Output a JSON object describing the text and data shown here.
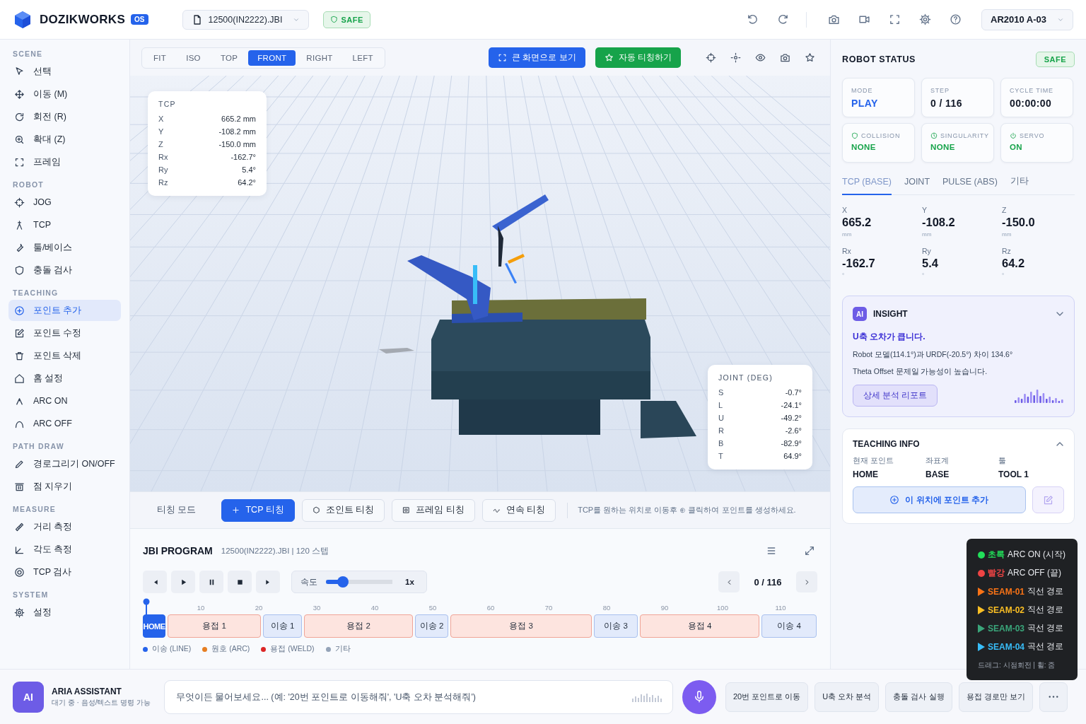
{
  "app": {
    "name": "DOZIKWORKS",
    "badge": "OS"
  },
  "file_menu": {
    "label": "12500(IN2222).JBI"
  },
  "safety_badge": "SAFE",
  "robot_select": {
    "label": "AR2010 A-03"
  },
  "view_tabs": [
    {
      "label": "FIT",
      "selected": false
    },
    {
      "label": "ISO",
      "selected": false
    },
    {
      "label": "TOP",
      "selected": false
    },
    {
      "label": "FRONT",
      "selected": true
    },
    {
      "label": "RIGHT",
      "selected": false
    },
    {
      "label": "LEFT",
      "selected": false
    }
  ],
  "view_buttons": [
    {
      "label": "큰 화면으로 보기",
      "kind": "primary"
    },
    {
      "label": "자동 티칭하기",
      "kind": "success"
    }
  ],
  "sidebar": [
    {
      "title": "SCENE",
      "items": [
        {
          "label": "선택",
          "selected": false
        },
        {
          "label": "이동 (M)",
          "selected": false
        },
        {
          "label": "회전 (R)",
          "selected": false
        },
        {
          "label": "확대 (Z)",
          "selected": false
        },
        {
          "label": "프레임",
          "selected": false
        }
      ]
    },
    {
      "title": "ROBOT",
      "items": [
        {
          "label": "JOG",
          "selected": false
        },
        {
          "label": "TCP",
          "selected": false
        },
        {
          "label": "툴/베이스",
          "selected": false
        },
        {
          "label": "충돌 검사",
          "selected": false
        }
      ]
    },
    {
      "title": "TEACHING",
      "items": [
        {
          "label": "포인트 추가",
          "selected": true
        },
        {
          "label": "포인트 수정",
          "selected": false
        },
        {
          "label": "포인트 삭제",
          "selected": false
        },
        {
          "label": "홈 설정",
          "selected": false
        },
        {
          "label": "ARC ON",
          "selected": false
        },
        {
          "label": "ARC OFF",
          "selected": false
        }
      ]
    },
    {
      "title": "PATH DRAW",
      "items": [
        {
          "label": "경로그리기 ON/OFF",
          "selected": false
        },
        {
          "label": "점 지우기",
          "selected": false
        }
      ]
    },
    {
      "title": "MEASURE",
      "items": [
        {
          "label": "거리 측정",
          "selected": false
        },
        {
          "label": "각도 측정",
          "selected": false
        },
        {
          "label": "TCP 검사",
          "selected": false
        }
      ]
    },
    {
      "title": "SYSTEM",
      "items": [
        {
          "label": "설정",
          "selected": false
        }
      ]
    }
  ],
  "tcp_card": {
    "title": "TCP",
    "rows": [
      {
        "axis": "X",
        "value": "665.2 mm"
      },
      {
        "axis": "Y",
        "value": "-108.2 mm"
      },
      {
        "axis": "Z",
        "value": "-150.0 mm"
      },
      {
        "axis": "Rx",
        "value": "-162.7°"
      },
      {
        "axis": "Ry",
        "value": "5.4°"
      },
      {
        "axis": "Rz",
        "value": "64.2°"
      }
    ]
  },
  "joint_card": {
    "title": "JOINT (DEG)",
    "rows": [
      {
        "axis": "S",
        "value": "-0.7°"
      },
      {
        "axis": "L",
        "value": "-24.1°"
      },
      {
        "axis": "U",
        "value": "-49.2°"
      },
      {
        "axis": "R",
        "value": "-2.6°"
      },
      {
        "axis": "B",
        "value": "-82.9°"
      },
      {
        "axis": "T",
        "value": "64.9°"
      }
    ]
  },
  "teaching_mode": {
    "label": "티칭 모드",
    "modes": [
      {
        "label": "TCP 티칭",
        "selected": true
      },
      {
        "label": "조인트 티칭",
        "selected": false
      },
      {
        "label": "프레임 티칭",
        "selected": false
      },
      {
        "label": "연속 티칭",
        "selected": false
      }
    ],
    "hint": "TCP를 원하는 위치로 이동후 ⊕ 클릭하여 포인트를 생성하세요."
  },
  "program": {
    "title": "JBI PROGRAM",
    "subtitle": "12500(IN2222).JBI | 120 스텝",
    "speed": {
      "label": "속도",
      "level": 0.25,
      "reading": "1x"
    },
    "step": "0 / 116",
    "ticks": [
      "10",
      "20",
      "30",
      "40",
      "50",
      "60",
      "70",
      "80",
      "90",
      "100",
      "110"
    ],
    "segments": [
      {
        "label": "HOME",
        "kind": "home"
      },
      {
        "label": "용접 1",
        "kind": "weld"
      },
      {
        "label": "이송 1",
        "kind": "move"
      },
      {
        "label": "용접 2",
        "kind": "weld"
      },
      {
        "label": "이송 2",
        "kind": "move"
      },
      {
        "label": "용접 3",
        "kind": "weld"
      },
      {
        "label": "이송 3",
        "kind": "move"
      },
      {
        "label": "용접 4",
        "kind": "weld"
      },
      {
        "label": "이송 4",
        "kind": "move"
      }
    ],
    "legend": [
      {
        "label": "이송 (LINE)",
        "color": "#2563eb"
      },
      {
        "label": "원호 (ARC)",
        "color": "#e67e22"
      },
      {
        "label": "용접 (WELD)",
        "color": "#dc2626"
      },
      {
        "label": "기타",
        "color": "#94a3b8"
      }
    ]
  },
  "robot_status": {
    "title": "ROBOT STATUS",
    "badge": "SAFE",
    "cards": [
      {
        "label": "MODE",
        "value": "PLAY",
        "kind": "mode"
      },
      {
        "label": "STEP",
        "value": "0 / 116",
        "kind": "plain"
      },
      {
        "label": "CYCLE TIME",
        "value": "00:00:00",
        "kind": "plain"
      },
      {
        "label": "COLLISION",
        "value": "NONE",
        "kind": "collision"
      },
      {
        "label": "SINGULARITY",
        "value": "NONE",
        "kind": "singularity"
      },
      {
        "label": "SERVO",
        "value": "ON",
        "kind": "servo"
      }
    ]
  },
  "position_tabs": [
    {
      "label": "TCP (BASE)",
      "selected": true
    },
    {
      "label": "JOINT",
      "selected": false
    },
    {
      "label": "PULSE (ABS)",
      "selected": false
    },
    {
      "label": "기타",
      "selected": false
    }
  ],
  "position_values": [
    {
      "axis": "X",
      "value": "665.2",
      "unit": "mm"
    },
    {
      "axis": "Y",
      "value": "-108.2",
      "unit": "mm"
    },
    {
      "axis": "Z",
      "value": "-150.0",
      "unit": "mm"
    },
    {
      "axis": "Rx",
      "value": "-162.7",
      "unit": "°"
    },
    {
      "axis": "Ry",
      "value": "5.4",
      "unit": "°"
    },
    {
      "axis": "Rz",
      "value": "64.2",
      "unit": "°"
    }
  ],
  "insight": {
    "badge": "AI",
    "title": "INSIGHT",
    "headline": "U축 오차가 큽니다.",
    "lines": [
      "Robot 모델(114.1°)과 URDF(-20.5°) 차이 134.6°",
      "Theta Offset 문제일 가능성이 높습니다."
    ],
    "button": "상세 분석 리포트"
  },
  "teaching_info": {
    "title": "TEACHING INFO",
    "fields": [
      {
        "label": "현재 포인트",
        "value": "HOME"
      },
      {
        "label": "좌표계",
        "value": "BASE"
      },
      {
        "label": "툴",
        "value": "TOOL 1"
      }
    ],
    "button": "이 위치에 포인트 추가"
  },
  "path_legend": {
    "items": [
      {
        "kind": "dot",
        "tag": "초록",
        "text": "ARC ON (시작)",
        "color": "#22e05a"
      },
      {
        "kind": "dot",
        "tag": "빨강",
        "text": "ARC OFF (끝)",
        "color": "#ef4444"
      },
      {
        "kind": "arrow",
        "tag": "SEAM-01",
        "text": "직선 경로",
        "color": "#f97316"
      },
      {
        "kind": "arrow",
        "tag": "SEAM-02",
        "text": "직선 경로",
        "color": "#fbbf24"
      },
      {
        "kind": "arrow",
        "tag": "SEAM-03",
        "text": "곡선 경로",
        "color": "#3aa57a"
      },
      {
        "kind": "arrow",
        "tag": "SEAM-04",
        "text": "곡선 경로",
        "color": "#38bdf8"
      }
    ],
    "footer": "드래그: 시점회전 | 휠: 줌"
  },
  "assistant": {
    "avatar": "AI",
    "name": "ARIA ASSISTANT",
    "status": "대기 중 · 음성/텍스트 명령 가능",
    "placeholder": "무엇이든 물어보세요... (예: '20번 포인트로 이동해줘', 'U축 오차 분석해줘')",
    "quick_actions": [
      "20번 포인트로 이동",
      "U축 오차 분석",
      "충돌 검사 실행",
      "용접 경로만 보기"
    ]
  }
}
